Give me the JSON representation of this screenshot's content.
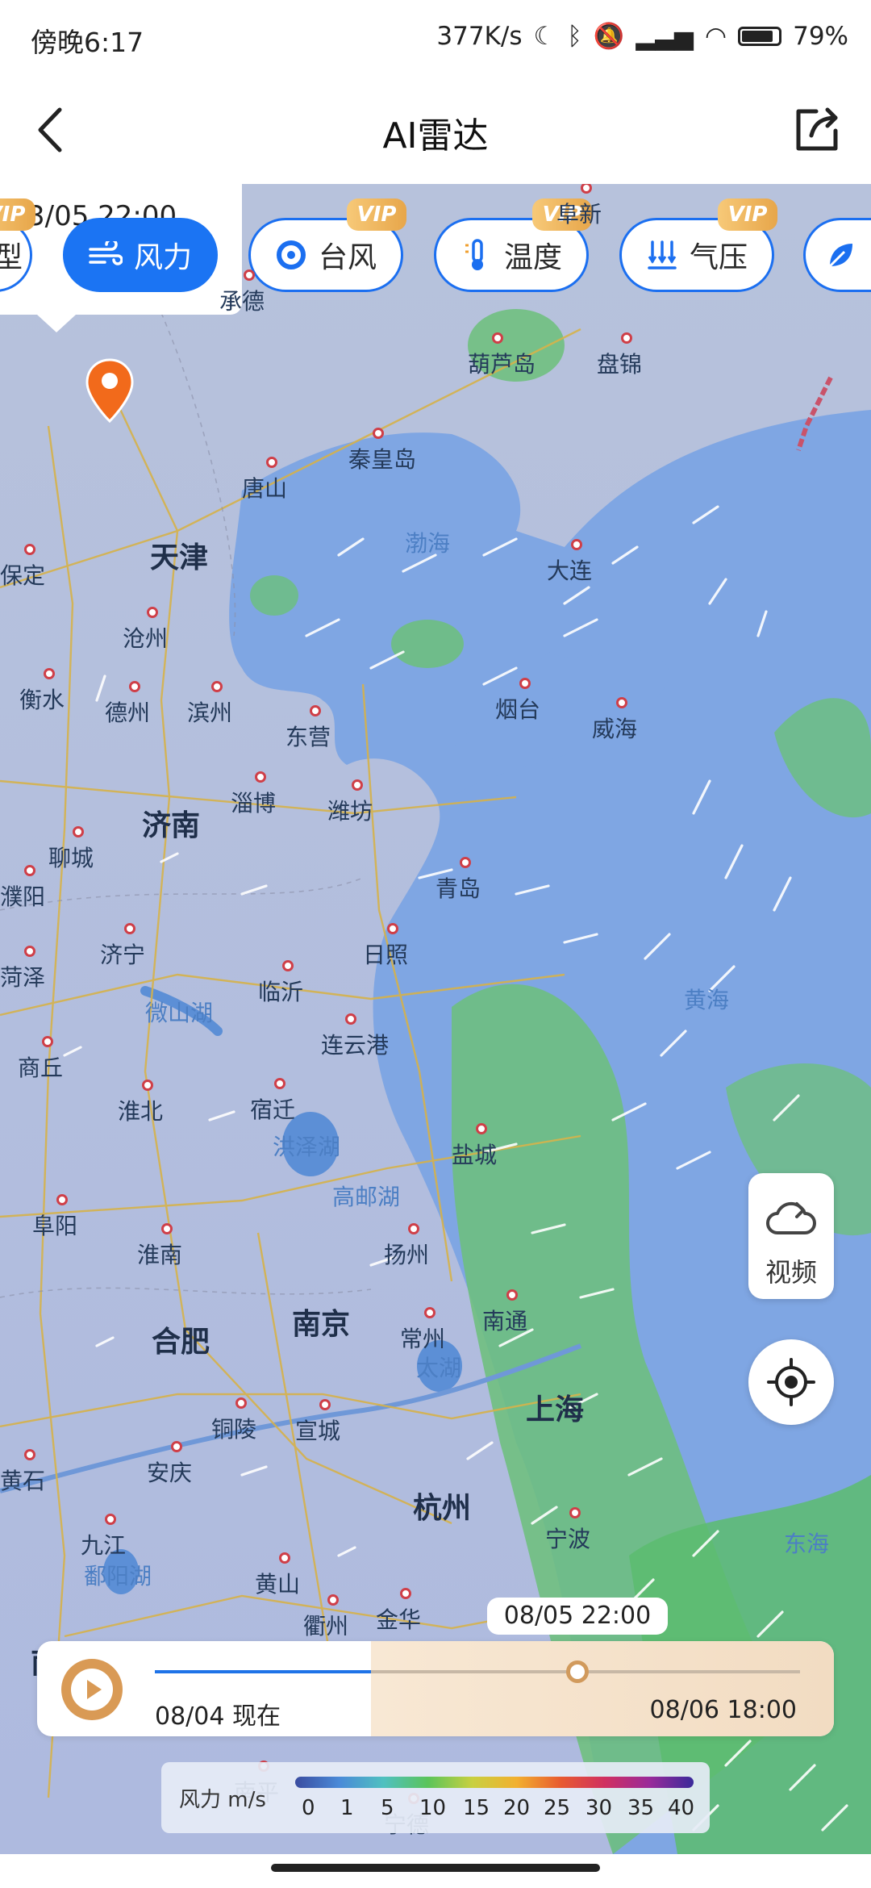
{
  "status_bar": {
    "time": "傍晚6:17",
    "net_speed": "377K/s",
    "battery": "79%"
  },
  "header": {
    "title": "AI雷达"
  },
  "chips": {
    "partial_left": "型",
    "items": [
      {
        "label": "风力",
        "vip": "",
        "active": true
      },
      {
        "label": "台风",
        "vip": "VIP"
      },
      {
        "label": "温度",
        "vip": "VIP"
      },
      {
        "label": "气压",
        "vip": "VIP"
      }
    ],
    "partial_date": "3/05 22:00"
  },
  "map": {
    "cities": [
      {
        "name": "阜新",
        "big": false
      },
      {
        "name": "承德",
        "big": false
      },
      {
        "name": "葫芦岛",
        "big": false
      },
      {
        "name": "盘锦",
        "big": false
      },
      {
        "name": "秦皇岛",
        "big": false
      },
      {
        "name": "唐山",
        "big": false
      },
      {
        "name": "天津",
        "big": true
      },
      {
        "name": "保定",
        "big": false
      },
      {
        "name": "沧州",
        "big": false
      },
      {
        "name": "大连",
        "big": false
      },
      {
        "name": "衡水",
        "big": false
      },
      {
        "name": "德州",
        "big": false
      },
      {
        "name": "滨州",
        "big": false
      },
      {
        "name": "东营",
        "big": false
      },
      {
        "name": "烟台",
        "big": false
      },
      {
        "name": "威海",
        "big": false
      },
      {
        "name": "济南",
        "big": true
      },
      {
        "name": "淄博",
        "big": false
      },
      {
        "name": "潍坊",
        "big": false
      },
      {
        "name": "聊城",
        "big": false
      },
      {
        "name": "濮阳",
        "big": false
      },
      {
        "name": "青岛",
        "big": false
      },
      {
        "name": "济宁",
        "big": false
      },
      {
        "name": "日照",
        "big": false
      },
      {
        "name": "菏泽",
        "big": false
      },
      {
        "name": "临沂",
        "big": false
      },
      {
        "name": "连云港",
        "big": false
      },
      {
        "name": "商丘",
        "big": false
      },
      {
        "name": "淮北",
        "big": false
      },
      {
        "name": "宿迁",
        "big": false
      },
      {
        "name": "盐城",
        "big": false
      },
      {
        "name": "阜阳",
        "big": false
      },
      {
        "name": "淮南",
        "big": false
      },
      {
        "name": "扬州",
        "big": false
      },
      {
        "name": "合肥",
        "big": true
      },
      {
        "name": "南京",
        "big": true
      },
      {
        "name": "南通",
        "big": false
      },
      {
        "name": "常州",
        "big": false
      },
      {
        "name": "上海",
        "big": true
      },
      {
        "name": "铜陵",
        "big": false
      },
      {
        "name": "宣城",
        "big": false
      },
      {
        "name": "黄石",
        "big": false
      },
      {
        "name": "安庆",
        "big": false
      },
      {
        "name": "杭州",
        "big": true
      },
      {
        "name": "九江",
        "big": false
      },
      {
        "name": "黄山",
        "big": false
      },
      {
        "name": "宁波",
        "big": false
      },
      {
        "name": "衢州",
        "big": false
      },
      {
        "name": "金华",
        "big": false
      },
      {
        "name": "南昌",
        "big": true
      },
      {
        "name": "南平",
        "big": false
      },
      {
        "name": "宁德",
        "big": false
      }
    ],
    "waters": [
      "渤海",
      "黄海",
      "东海",
      "微山湖",
      "洪泽湖",
      "高邮湖",
      "太湖",
      "鄱阳湖"
    ]
  },
  "controls": {
    "video_label": "视频"
  },
  "timeline": {
    "current": "08/05 22:00",
    "start": "08/04 现在",
    "end": "08/06 18:00",
    "progress": 0.63
  },
  "legend": {
    "title": "风力 m/s",
    "ticks": [
      "0",
      "1",
      "5",
      "10",
      "15",
      "20",
      "25",
      "30",
      "35",
      "40"
    ]
  },
  "colors": {
    "accent": "#1b74f3",
    "vip": "#e9aa4d",
    "play": "#d99a55"
  }
}
